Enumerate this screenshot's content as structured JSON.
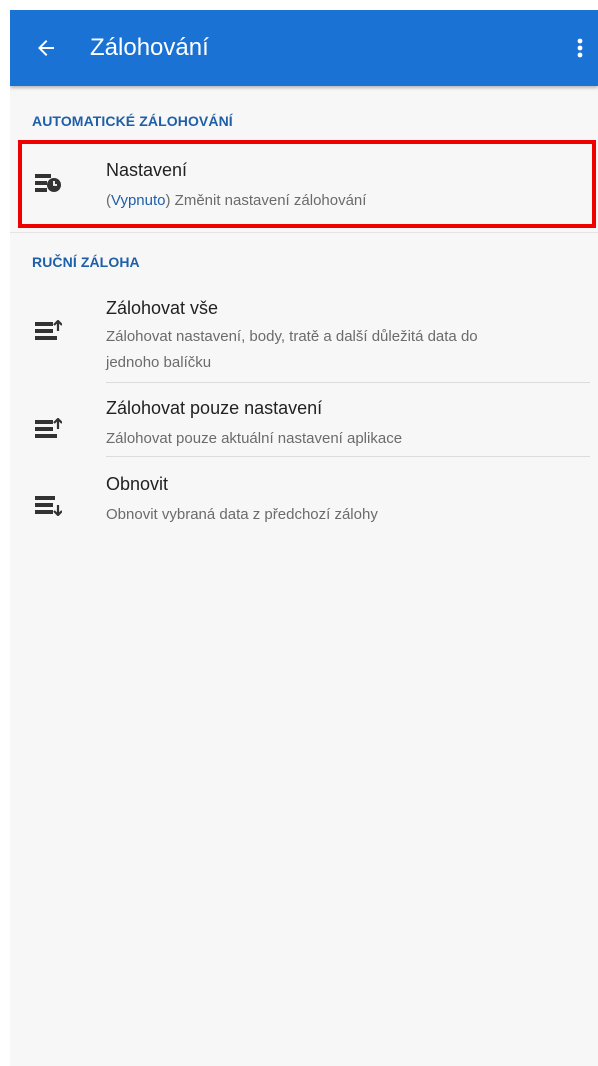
{
  "header": {
    "title": "Zálohování",
    "back_icon": "arrow-back-icon",
    "menu_icon": "more-vert-icon"
  },
  "sections": {
    "auto": {
      "header": "AUTOMATICKÉ ZÁLOHOVÁNÍ",
      "item": {
        "title": "Nastavení",
        "status_open": "(",
        "status": "Vypnuto",
        "status_close": ")",
        "subtitle": " Změnit nastavení zálohování",
        "icon": "backup-schedule-icon"
      }
    },
    "manual": {
      "header": "RUČNÍ ZÁLOHA",
      "items": [
        {
          "title": "Zálohovat vše",
          "subtitle_line1": "Zálohovat nastavení, body, tratě a další důležitá data do",
          "subtitle_line2": "jednoho balíčku",
          "icon": "backup-list-icon"
        },
        {
          "title": "Zálohovat pouze nastavení",
          "subtitle_line1": "Zálohovat pouze aktuální nastavení aplikace",
          "icon": "backup-list-icon"
        },
        {
          "title": "Obnovit",
          "subtitle_line1": "Obnovit vybraná data z předchozí zálohy",
          "icon": "restore-list-icon"
        }
      ]
    }
  },
  "colors": {
    "toolbar": "#1a73d4",
    "section_header": "#1e5fa8",
    "highlight": "#ee0000"
  }
}
